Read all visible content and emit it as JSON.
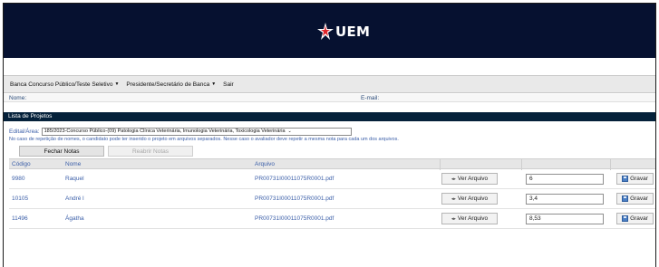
{
  "header": {
    "logo_text": "UEM",
    "bg_color": "#061130"
  },
  "menu": {
    "items": [
      {
        "label": "Banca Concurso Público/Teste Seletivo",
        "has_dropdown": true
      },
      {
        "label": "Presidente/Secretário de Banca",
        "has_dropdown": true
      },
      {
        "label": "Sair",
        "has_dropdown": false
      }
    ]
  },
  "user": {
    "name_label": "Nome:",
    "email_label": "E-mail:"
  },
  "list": {
    "title": "Lista de Projetos",
    "edital_label": "Edital/Área:",
    "edital_selected": "185/2023-Concurso Público-(09) Patologia Clínica Veterinária, Imunologia Veterinária, Toxicologia Veterinária",
    "notice": "No caso de repetição de nomes, o candidato pode ter inserido o projeto em arquivos separados. Nesse caso o avaliador deve repetir a mesma nota para cada um dos arquivos.",
    "fechar_label": "Fechar Notas",
    "reabrir_label": "Reabrir Notas"
  },
  "table": {
    "columns": [
      "Código",
      "Nome",
      "Arquivo"
    ],
    "rows": [
      {
        "codigo": "9980",
        "nome": "Raquel",
        "arquivo": "PR00731I00011075R0001.pdf",
        "ver_label": "Ver Arquivo",
        "nota": "6",
        "gravar_label": "Gravar"
      },
      {
        "codigo": "10105",
        "nome": "André l",
        "arquivo": "PR00731I00011075R0001.pdf",
        "ver_label": "Ver Arquivo",
        "nota": "3,4",
        "gravar_label": "Gravar"
      },
      {
        "codigo": "11496",
        "nome": "Ágatha",
        "arquivo": "PR00731I00011075R0001.pdf",
        "ver_label": "Ver Arquivo",
        "nota": "8,53",
        "gravar_label": "Gravar"
      }
    ]
  },
  "colors": {
    "link_text": "#3a5ea8",
    "list_bar": "#05213a"
  }
}
